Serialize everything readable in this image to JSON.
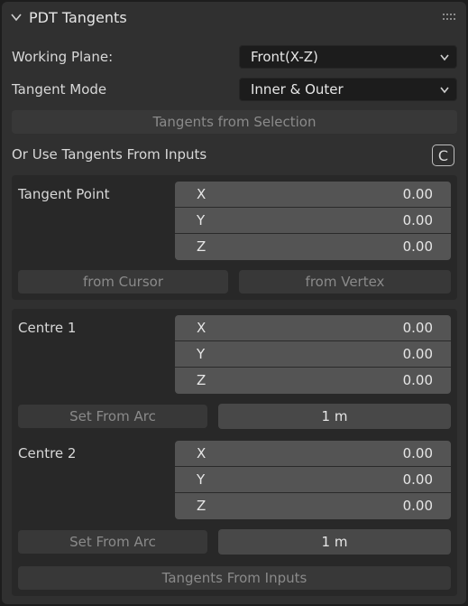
{
  "header": {
    "title": "PDT Tangents"
  },
  "working_plane": {
    "label": "Working Plane:",
    "value": "Front(X-Z)"
  },
  "tangent_mode": {
    "label": "Tangent Mode",
    "value": "Inner & Outer"
  },
  "tangents_from_selection": "Tangents from Selection",
  "use_inputs": {
    "label": "Or Use Tangents From Inputs",
    "icon_char": "C"
  },
  "tangent_point": {
    "label": "Tangent Point",
    "x_label": "X",
    "x": "0.00",
    "y_label": "Y",
    "y": "0.00",
    "z_label": "Z",
    "z": "0.00",
    "from_cursor": "from Cursor",
    "from_vertex": "from Vertex"
  },
  "centre1": {
    "label": "Centre 1",
    "x_label": "X",
    "x": "0.00",
    "y_label": "Y",
    "y": "0.00",
    "z_label": "Z",
    "z": "0.00",
    "set_from_arc": "Set From Arc",
    "radius": "1 m"
  },
  "centre2": {
    "label": "Centre 2",
    "x_label": "X",
    "x": "0.00",
    "y_label": "Y",
    "y": "0.00",
    "z_label": "Z",
    "z": "0.00",
    "set_from_arc": "Set From Arc",
    "radius": "1 m"
  },
  "tangents_from_inputs": "Tangents From Inputs",
  "colors": {
    "panel": "#303030",
    "field": "#545454",
    "dropdown": "#1c1c1c",
    "inset": "#282828"
  }
}
